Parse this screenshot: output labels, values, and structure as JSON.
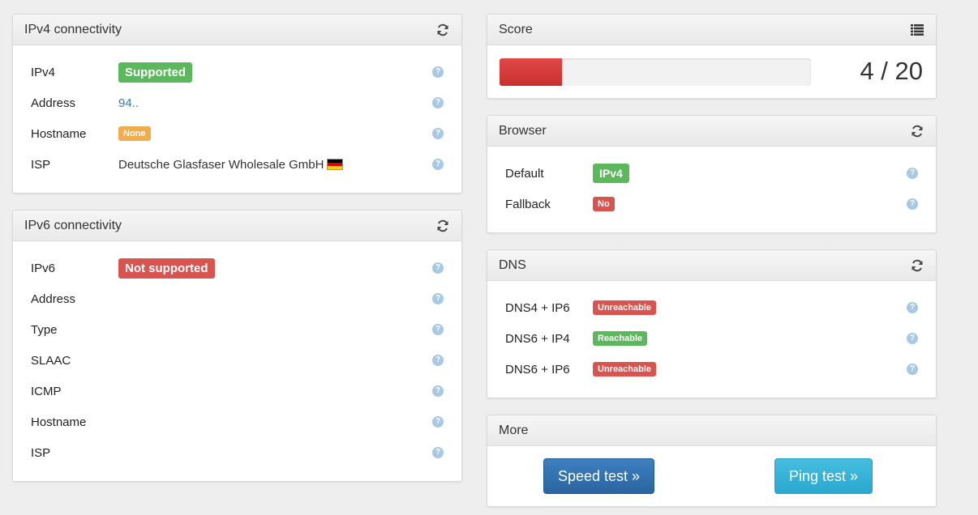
{
  "ipv4": {
    "title": "IPv4 connectivity",
    "refresh_icon": "refresh-icon",
    "rows": [
      {
        "label": "IPv4",
        "value": "Supported"
      },
      {
        "label": "Address",
        "value": "94.."
      },
      {
        "label": "Hostname",
        "value": "None"
      },
      {
        "label": "ISP",
        "value": "Deutsche Glasfaser Wholesale GmbH"
      }
    ],
    "colors": {
      "supported": "#5cb85c",
      "none": "#f0ad4e",
      "address": "#3a7ab8"
    }
  },
  "ipv6": {
    "title": "IPv6 connectivity",
    "refresh_icon": "refresh-icon",
    "rows": [
      {
        "label": "IPv6",
        "value": "Not supported"
      },
      {
        "label": "Address",
        "value": ""
      },
      {
        "label": "Type",
        "value": ""
      },
      {
        "label": "SLAAC",
        "value": ""
      },
      {
        "label": "ICMP",
        "value": ""
      },
      {
        "label": "Hostname",
        "value": ""
      },
      {
        "label": "ISP",
        "value": ""
      }
    ],
    "colors": {
      "not_supported": "#d9534f"
    }
  },
  "score": {
    "title": "Score",
    "list_icon": "list-icon",
    "value": 4,
    "max": 20,
    "text": "4 / 20",
    "bar_color": "#d9534f"
  },
  "browser": {
    "title": "Browser",
    "refresh_icon": "refresh-icon",
    "rows": [
      {
        "label": "Default",
        "value": "IPv4"
      },
      {
        "label": "Fallback",
        "value": "No"
      }
    ]
  },
  "dns": {
    "title": "DNS",
    "refresh_icon": "refresh-icon",
    "rows": [
      {
        "label": "DNS4 + IP6",
        "value": "Unreachable"
      },
      {
        "label": "DNS6 + IP4",
        "value": "Reachable"
      },
      {
        "label": "DNS6 + IP6",
        "value": "Unreachable"
      }
    ]
  },
  "more": {
    "title": "More",
    "speed_test_label": "Speed test »",
    "ping_test_label": "Ping test »"
  },
  "help_icon_glyph": "?"
}
